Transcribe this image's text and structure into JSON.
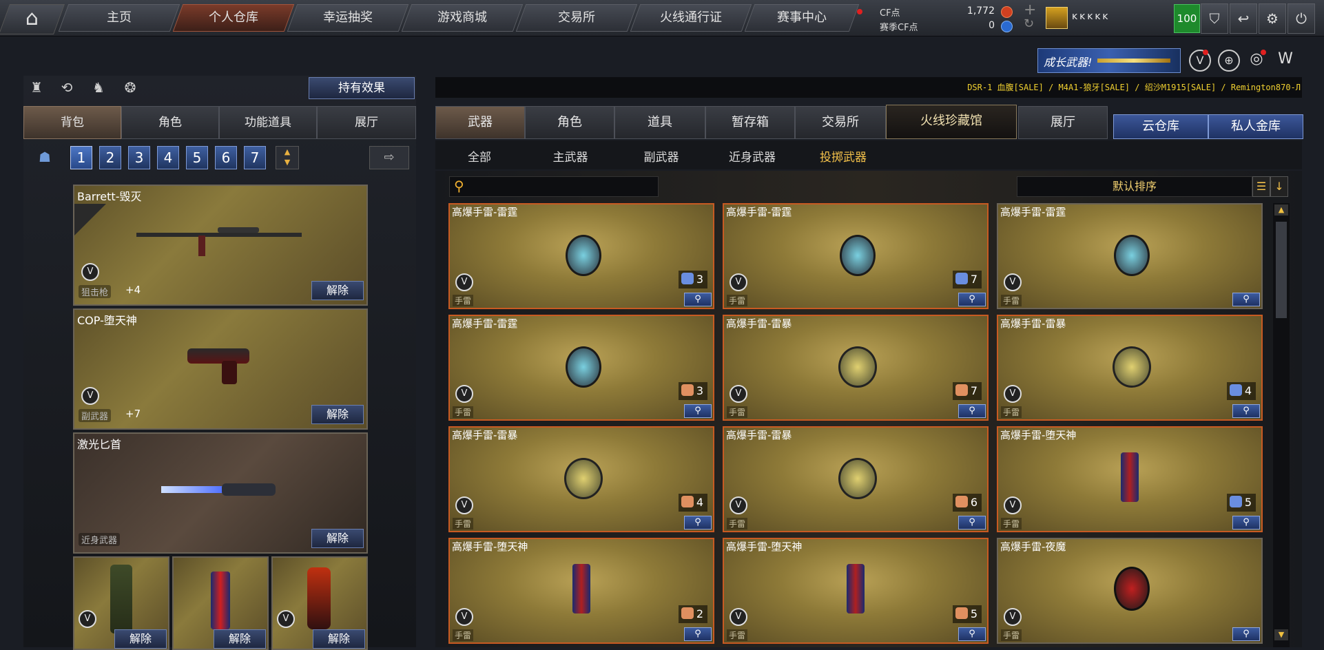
{
  "topnav": {
    "home": "⌂",
    "items": [
      "主页",
      "个人仓库",
      "幸运抽奖",
      "游戏商城",
      "交易所",
      "火线通行证",
      "赛事中心"
    ],
    "active": "个人仓库"
  },
  "currency": {
    "cf_label": "CF点",
    "cf_value": "1,772",
    "season_label": "赛季CF点",
    "season_value": "0"
  },
  "player": {
    "name": "ĸĸĸĸĸ",
    "level": "100"
  },
  "banner": {
    "title": "成长武器!"
  },
  "ticker": "DSR-1 血腹[SALE] / M4A1-狼牙[SALE] / 绍沙M1915[SALE] / Remington870-Л",
  "left": {
    "effect_button": "持有效果",
    "tabs": [
      "背包",
      "角色",
      "功能道具",
      "展厅"
    ],
    "pages": [
      "1",
      "2",
      "3",
      "4",
      "5",
      "6",
      "7"
    ],
    "slots": [
      {
        "name": "Barrett-毁灭",
        "type": "狙击枪",
        "plus": "+4",
        "action": "解除"
      },
      {
        "name": "COP-堕天神",
        "type": "副武器",
        "plus": "+7",
        "action": "解除"
      },
      {
        "name": "激光匕首",
        "type": "近身武器",
        "plus": "",
        "action": "解除"
      }
    ],
    "grenade_slots": [
      {
        "action": "解除"
      },
      {
        "action": "解除"
      },
      {
        "action": "解除"
      }
    ]
  },
  "right": {
    "tabs": [
      "武器",
      "角色",
      "道具",
      "暂存箱",
      "交易所",
      "火线珍藏馆",
      "展厅"
    ],
    "cloud_tabs": [
      "云仓库",
      "私人金库"
    ],
    "subtabs": [
      "全部",
      "主武器",
      "副武器",
      "近身武器",
      "投掷武器"
    ],
    "active_subtab": "投掷武器",
    "search_placeholder": "",
    "sort_label": "默认排序",
    "cards": [
      {
        "title": "高爆手雷-雷霆",
        "type": "手雷",
        "count": "3",
        "bag": "blue",
        "border": true
      },
      {
        "title": "高爆手雷-雷霆",
        "type": "手雷",
        "count": "7",
        "bag": "blue",
        "border": true
      },
      {
        "title": "高爆手雷-雷霆",
        "type": "手雷",
        "count": "",
        "bag": "",
        "border": false
      },
      {
        "title": "高爆手雷-雷霆",
        "type": "手雷",
        "count": "3",
        "bag": "orange",
        "border": true
      },
      {
        "title": "高爆手雷-雷暴",
        "type": "手雷",
        "count": "7",
        "bag": "orange",
        "border": true
      },
      {
        "title": "高爆手雷-雷暴",
        "type": "手雷",
        "count": "4",
        "bag": "blue",
        "border": true
      },
      {
        "title": "高爆手雷-雷暴",
        "type": "手雷",
        "count": "4",
        "bag": "orange",
        "border": true
      },
      {
        "title": "高爆手雷-雷暴",
        "type": "手雷",
        "count": "6",
        "bag": "orange",
        "border": true
      },
      {
        "title": "高爆手雷-堕天神",
        "type": "手雷",
        "count": "5",
        "bag": "blue",
        "border": true
      },
      {
        "title": "高爆手雷-堕天神",
        "type": "手雷",
        "count": "2",
        "bag": "orange",
        "border": true
      },
      {
        "title": "高爆手雷-堕天神",
        "type": "手雷",
        "count": "5",
        "bag": "orange",
        "border": true
      },
      {
        "title": "高爆手雷-夜魔",
        "type": "手雷",
        "count": "",
        "bag": "",
        "border": false
      }
    ]
  },
  "colors": {
    "accent": "#c85a22",
    "blue_btn": "#3c5ba0",
    "gold_text": "#f2c04a",
    "level_green": "#1e8a2c"
  }
}
